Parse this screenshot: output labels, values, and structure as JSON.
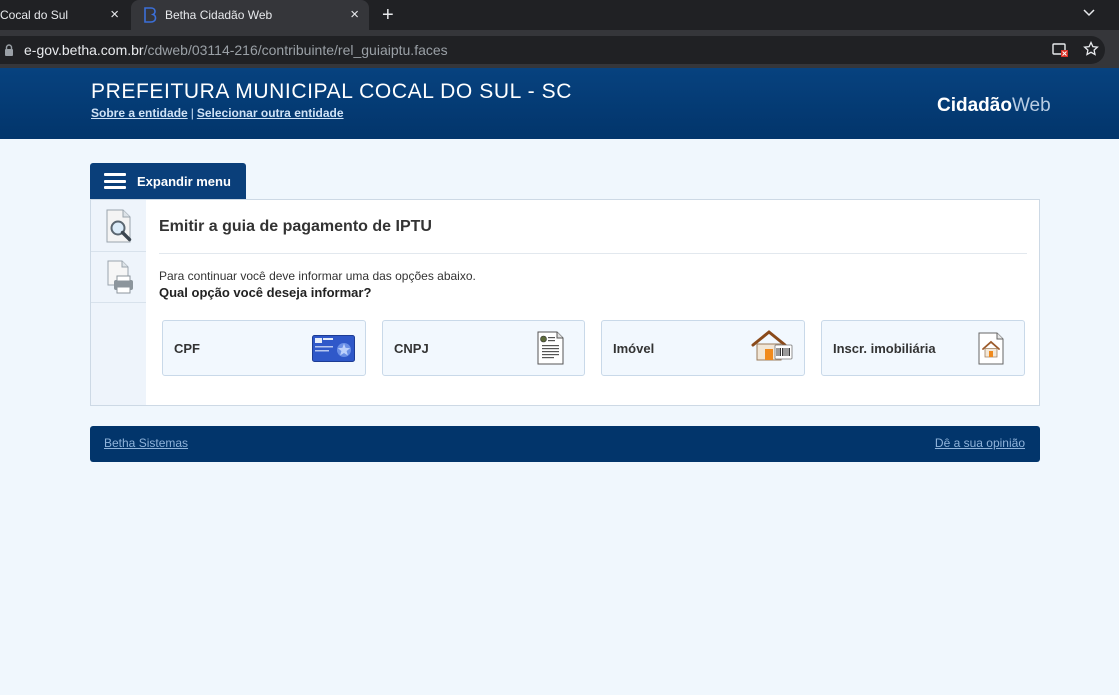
{
  "browser": {
    "tabs": [
      {
        "title": "Cocal do Sul",
        "close": "×"
      },
      {
        "title": "Betha Cidadão Web",
        "close": "×"
      }
    ],
    "new_tab": "+",
    "url_host": "e-gov.betha.com.br",
    "url_path": "/cdweb/03114-216/contribuinte/rel_guiaiptu.faces",
    "icons": [
      "lock-icon",
      "tab-search-icon",
      "cast-blocked-icon",
      "bookmark-star-icon"
    ]
  },
  "header": {
    "title": "PREFEITURA MUNICIPAL COCAL DO SUL - SC",
    "link_about": "Sobre a entidade",
    "separator": "|",
    "link_select": "Selecionar outra entidade",
    "brand_part1": "Cidadão",
    "brand_part2": "Web"
  },
  "menu": {
    "expand_label": "Expandir menu"
  },
  "main": {
    "title": "Emitir a guia de pagamento de IPTU",
    "instruction": "Para continuar você deve informar uma das opções abaixo.",
    "question": "Qual opção você deseja informar?",
    "options": [
      {
        "label": "CPF",
        "icon": "cpf-card-icon"
      },
      {
        "label": "CNPJ",
        "icon": "document-icon"
      },
      {
        "label": "Imóvel",
        "icon": "house-barcode-icon"
      },
      {
        "label": "Inscr. imobiliária",
        "icon": "house-document-icon"
      }
    ]
  },
  "footer": {
    "left_link": "Betha Sistemas",
    "right_link": "Dê a sua opinião"
  },
  "colors": {
    "header_blue": "#07427f",
    "footer_blue": "#02356b",
    "page_bg": "#f0f7fd"
  }
}
